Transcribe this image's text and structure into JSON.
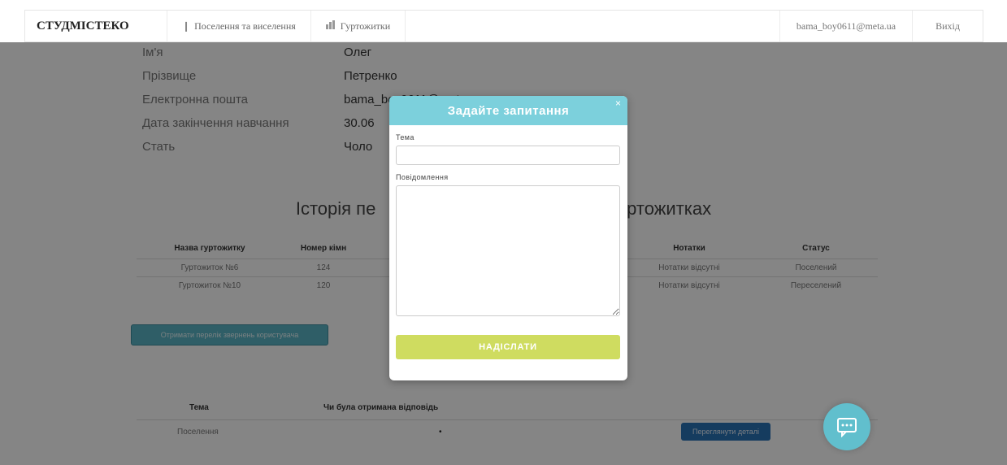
{
  "navbar": {
    "brand": "СТУДМІСТЕКО",
    "items": [
      {
        "icon": "pin-icon",
        "label": "Поселення та виселення"
      },
      {
        "icon": "building-icon",
        "label": "Гуртожитки"
      }
    ],
    "user_email": "bama_boy0611@meta.ua",
    "logout": "Вихід"
  },
  "profile": {
    "rows": [
      {
        "label": "Ім'я",
        "value": "Олег"
      },
      {
        "label": "Прізвище",
        "value": "Петренко"
      },
      {
        "label": "Електронна пошта",
        "value": "bama_boy0611@meta.ua"
      },
      {
        "label": "Дата закінчення навчання",
        "value": "30.06"
      },
      {
        "label": "Стать",
        "value": "Чоло"
      }
    ]
  },
  "history": {
    "title_left": "Історія пе",
    "title_right": "гуртожитках",
    "headers": [
      "Назва гуртожитку",
      "Номер кімн",
      "",
      "Нотатки",
      "Статус"
    ],
    "rows": [
      [
        "Гуртожиток №6",
        "124",
        "",
        "Нотатки відсутні",
        "Поселений"
      ],
      [
        "Гуртожиток №10",
        "120",
        "",
        "Нотатки відсутні",
        "Переселений"
      ]
    ]
  },
  "request_button": "Отримати перелік звернень користувача",
  "questions": {
    "headers": [
      "Тема",
      "Чи була отримана відповідь"
    ],
    "rows": [
      {
        "topic": "Поселення",
        "answered": "•",
        "button": "Переглянути деталі"
      }
    ]
  },
  "modal": {
    "title": "Задайте запитання",
    "close": "×",
    "subject_label": "Тема",
    "subject_value": "",
    "message_label": "Повідомлення",
    "message_value": "",
    "send_label": "НАДІСЛАТИ"
  },
  "colors": {
    "overlay": "#000000",
    "modal_header": "#7cd0dc",
    "send_button": "#cfdc60",
    "request_button": "#5bb5c6",
    "details_button": "#2a73b7",
    "chat_fab": "#61bfcd"
  },
  "chat_fab": {
    "icon": "chat-icon"
  }
}
